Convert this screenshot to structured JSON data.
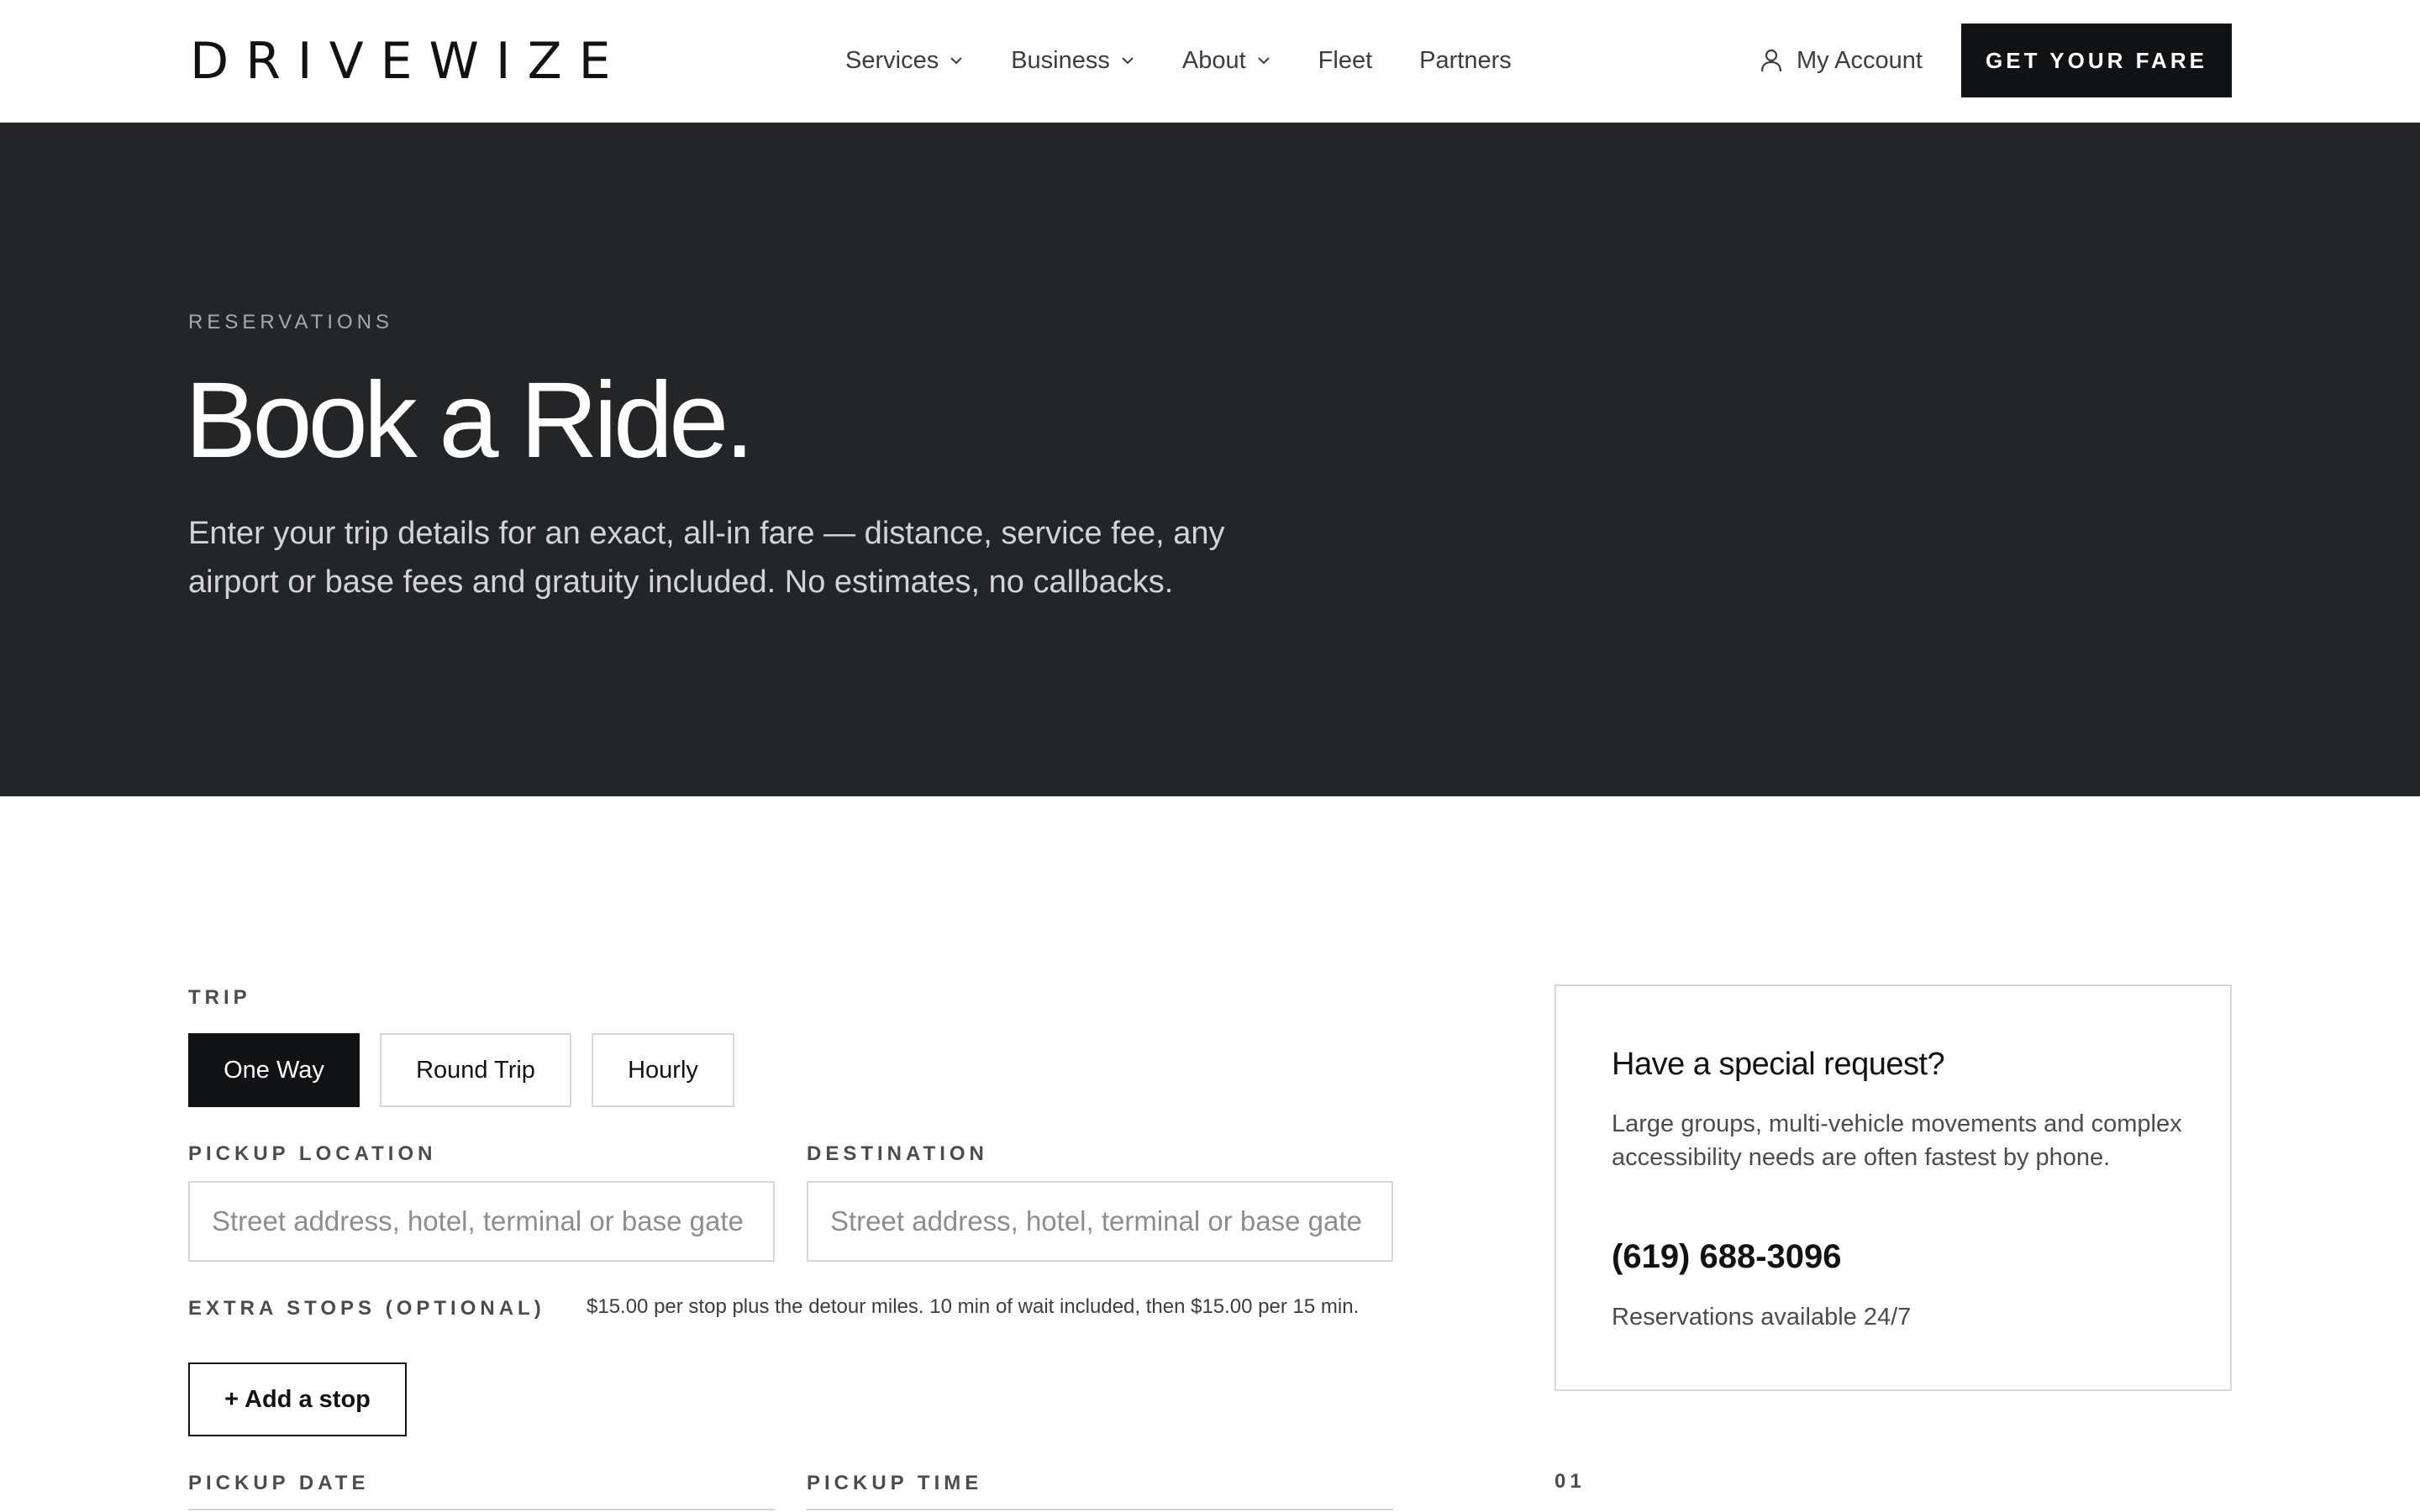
{
  "header": {
    "logo_text": "DRIVEWIZE",
    "nav": [
      {
        "label": "Services",
        "has_dropdown": true
      },
      {
        "label": "Business",
        "has_dropdown": true
      },
      {
        "label": "About",
        "has_dropdown": true
      },
      {
        "label": "Fleet",
        "has_dropdown": false
      },
      {
        "label": "Partners",
        "has_dropdown": false
      }
    ],
    "account_label": "My Account",
    "account_icon": "user-icon",
    "cta_label": "GET YOUR FARE"
  },
  "hero": {
    "eyebrow": "RESERVATIONS",
    "title": "Book a Ride.",
    "subtitle": "Enter your trip details for an exact, all-in fare — distance, service fee, any airport or base fees and gratuity included. No estimates, no callbacks."
  },
  "form": {
    "trip_label": "TRIP",
    "trip_options": [
      "One Way",
      "Round Trip",
      "Hourly"
    ],
    "trip_selected": "One Way",
    "pickup_label": "PICKUP LOCATION",
    "pickup_placeholder": "Street address, hotel, terminal or base gate",
    "pickup_value": "",
    "destination_label": "DESTINATION",
    "destination_placeholder": "Street address, hotel, terminal or base gate",
    "destination_value": "",
    "extra_stops_label": "EXTRA STOPS (OPTIONAL)",
    "extra_stops_note": "$15.00 per stop plus the detour miles. 10 min of wait included, then $15.00 per 15 min.",
    "add_stop_label": "+ Add a stop",
    "pickup_date_label": "PICKUP DATE",
    "pickup_time_label": "PICKUP TIME"
  },
  "side_card": {
    "title": "Have a special request?",
    "body": "Large groups, multi-vehicle movements and complex accessibility needs are often fastest by phone.",
    "phone": "(619) 688-3096",
    "note": "Reservations available 24/7"
  },
  "step": {
    "number": "01"
  },
  "colors": {
    "dark": "#111214",
    "hero_bg": "#242527",
    "border": "#d7d8db"
  }
}
